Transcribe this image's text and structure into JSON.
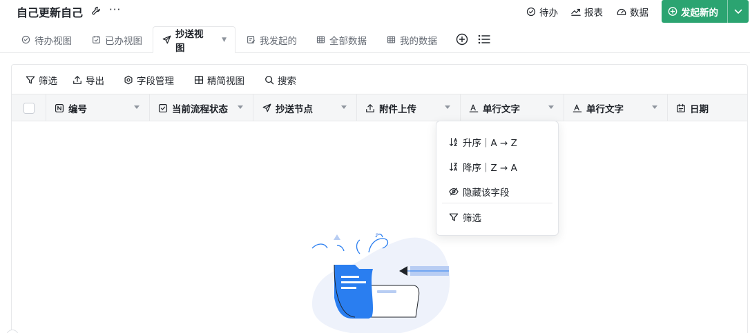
{
  "app": {
    "title": "自己更新自己",
    "more": "···"
  },
  "header_actions": [
    {
      "label": "待办",
      "icon": "check-circle-icon"
    },
    {
      "label": "报表",
      "icon": "trend-chart-icon"
    },
    {
      "label": "数据",
      "icon": "dashboard-icon"
    }
  ],
  "launch_button": {
    "label": "发起新的",
    "icon": "plus-circle-icon",
    "color": "#2ba471"
  },
  "tabs": [
    {
      "label": "待办视图",
      "icon": "check-circle-icon"
    },
    {
      "label": "已办视图",
      "icon": "calendar-check-icon"
    },
    {
      "label": "抄送视图",
      "icon": "send-icon",
      "active": true
    },
    {
      "label": "我发起的",
      "icon": "edit-doc-icon"
    },
    {
      "label": "全部数据",
      "icon": "table-icon"
    },
    {
      "label": "我的数据",
      "icon": "table-icon"
    }
  ],
  "toolbar": {
    "filter": "筛选",
    "export": "导出",
    "fields": "字段管理",
    "compact": "精简视图",
    "search": "搜索"
  },
  "columns": [
    {
      "label": "编号",
      "icon": "number-field-icon"
    },
    {
      "label": "当前流程状态",
      "icon": "checkbox-field-icon"
    },
    {
      "label": "抄送节点",
      "icon": "send-icon"
    },
    {
      "label": "附件上传",
      "icon": "upload-icon"
    },
    {
      "label": "单行文字",
      "icon": "text-field-icon"
    },
    {
      "label": "单行文字",
      "icon": "text-field-icon"
    },
    {
      "label": "日期",
      "icon": "calendar-icon"
    }
  ],
  "column_menu": {
    "sort_asc": "升序｜A → Z",
    "sort_desc": "降序｜Z → A",
    "hide_field": "隐藏该字段",
    "filter": "筛选"
  },
  "colors": {
    "accent_green": "#2ba471",
    "illustration_blue": "#2a7ef0"
  }
}
